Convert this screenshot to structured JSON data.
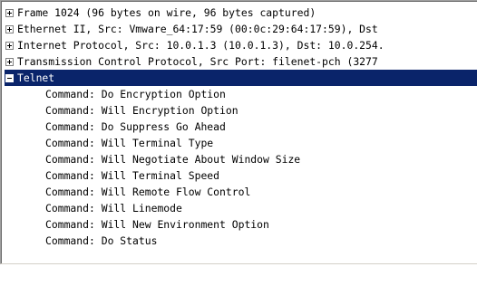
{
  "tree": {
    "rows": [
      {
        "expander": "plus",
        "text": "Frame 1024 (96 bytes on wire, 96 bytes captured)"
      },
      {
        "expander": "plus",
        "text": "Ethernet II, Src: Vmware_64:17:59 (00:0c:29:64:17:59), Dst"
      },
      {
        "expander": "plus",
        "text": "Internet Protocol, Src: 10.0.1.3 (10.0.1.3), Dst: 10.0.254."
      },
      {
        "expander": "plus",
        "text": "Transmission Control Protocol, Src Port: filenet-pch (3277"
      },
      {
        "expander": "minus",
        "text": "Telnet",
        "selected": true
      }
    ],
    "telnet_children": [
      "Command: Do Encryption Option",
      "Command: Will Encryption Option",
      "Command: Do Suppress Go Ahead",
      "Command: Will Terminal Type",
      "Command: Will Negotiate About Window Size",
      "Command: Will Terminal Speed",
      "Command: Will Remote Flow Control",
      "Command: Will Linemode",
      "Command: Will New Environment Option",
      "Command: Do Status"
    ]
  }
}
